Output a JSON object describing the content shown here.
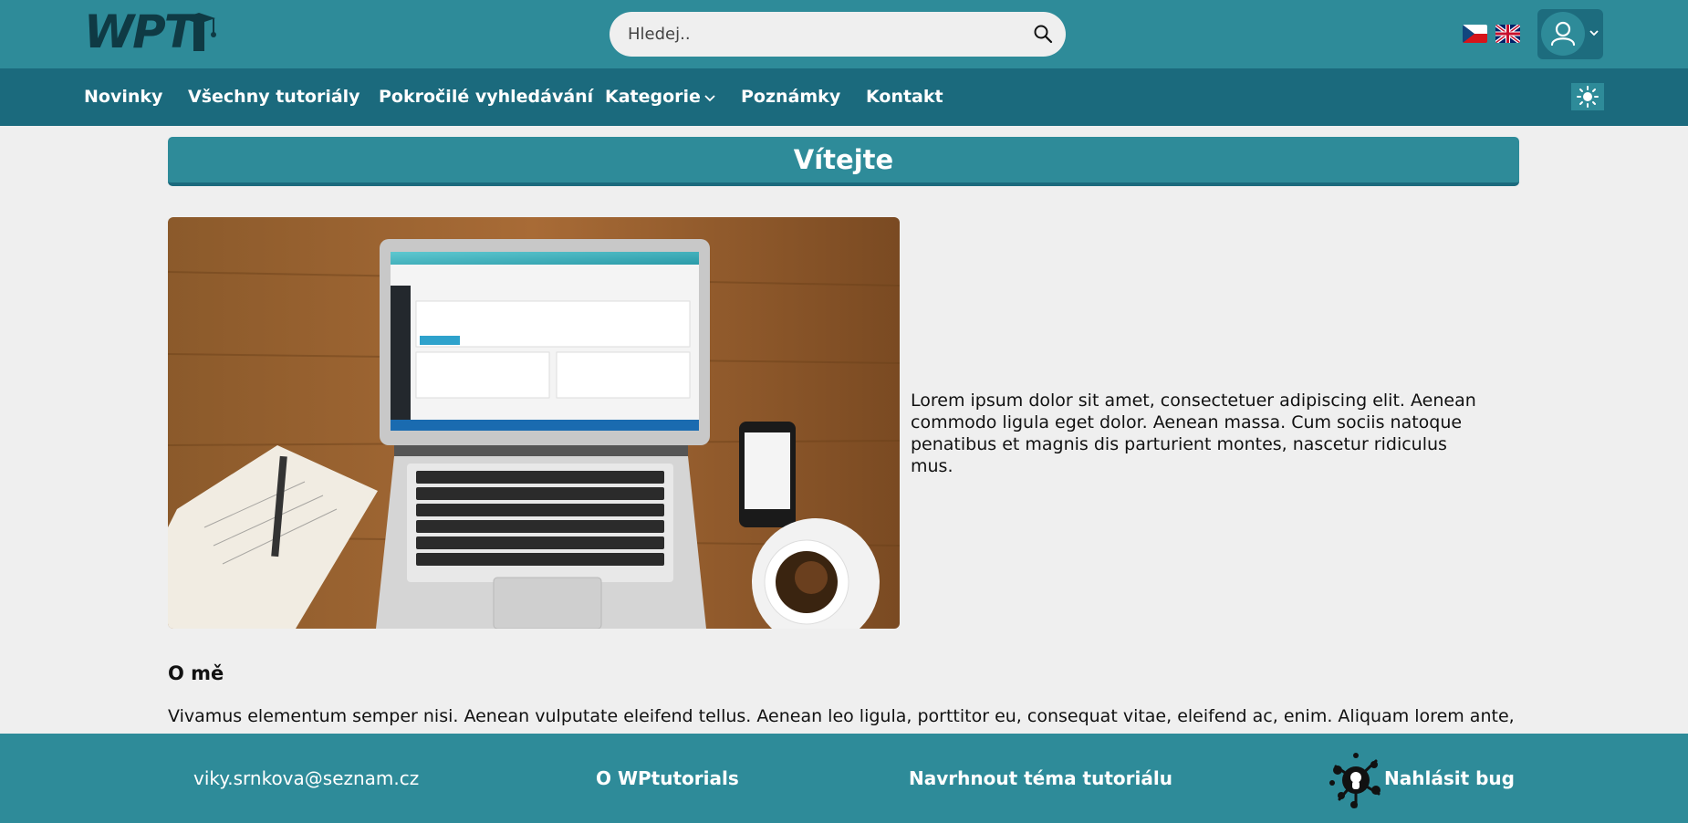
{
  "header": {
    "logo_text": "WPT",
    "search": {
      "placeholder": "Hledej.."
    },
    "languages": [
      "cs",
      "en"
    ]
  },
  "nav": {
    "items": [
      {
        "label": "Novinky"
      },
      {
        "label": "Všechny tutoriály"
      },
      {
        "label": "Pokročilé vyhledávání"
      },
      {
        "label": "Kategorie",
        "has_dropdown": true
      },
      {
        "label": "Poznámky"
      },
      {
        "label": "Kontakt"
      }
    ]
  },
  "main": {
    "welcome_title": "Vítejte",
    "intro": "Lorem ipsum dolor sit amet, consectetuer adipiscing elit. Aenean commodo ligula eget dolor. Aenean massa. Cum sociis natoque penatibus et magnis dis parturient montes, nascetur ridiculus mus.",
    "about_heading": "O mě",
    "about_text": "Vivamus elementum semper nisi. Aenean vulputate eleifend tellus. Aenean leo ligula, porttitor eu, consequat vitae, eleifend ac, enim. Aliquam lorem ante,"
  },
  "footer": {
    "email": "viky.srnkova@seznam.cz",
    "about": "O WPtutorials",
    "suggest": "Navrhnout téma tutoriálu",
    "bug": "Nahlásit bug"
  },
  "colors": {
    "primary": "#2e8b99",
    "nav": "#1b6a7d",
    "background": "#efefef"
  }
}
